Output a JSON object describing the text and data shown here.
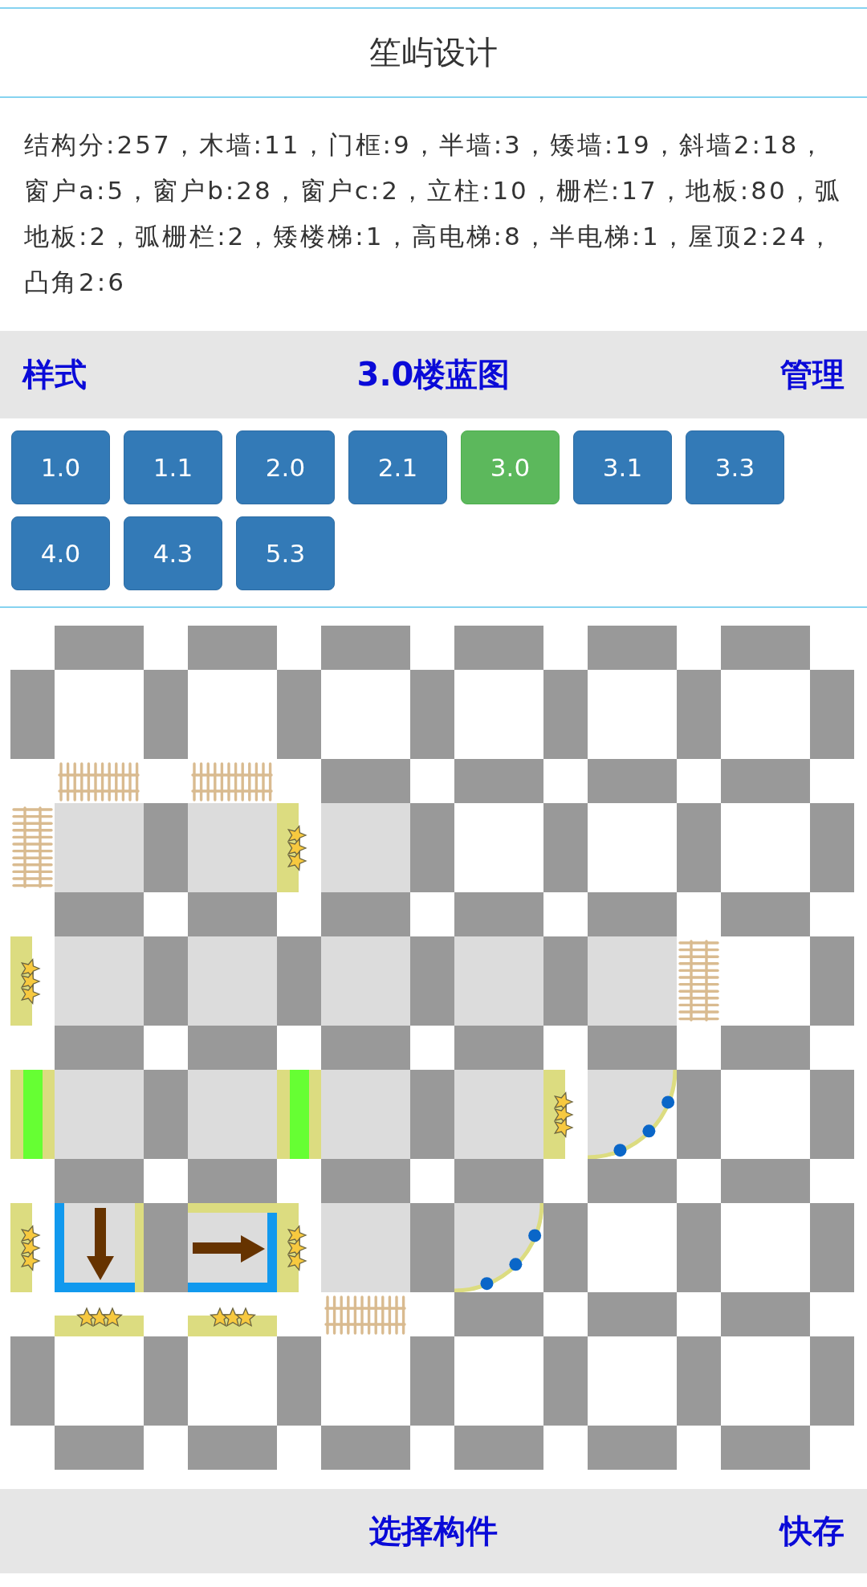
{
  "header": {
    "title": "笙屿设计"
  },
  "summary": "结构分:257，木墙:11，门框:9，半墙:3，矮墙:19，斜墙2:18，窗户a:5，窗户b:28，窗户c:2，立柱:10，栅栏:17，地板:80，弧地板:2，弧栅栏:2，矮楼梯:1，高电梯:8，半电梯:1，屋顶2:24，凸角2:6",
  "toolbar": {
    "left": "样式",
    "title": "3.0楼蓝图",
    "right": "管理"
  },
  "floors": [
    {
      "label": "1.0",
      "selected": false
    },
    {
      "label": "1.1",
      "selected": false
    },
    {
      "label": "2.0",
      "selected": false
    },
    {
      "label": "2.1",
      "selected": false
    },
    {
      "label": "3.0",
      "selected": true
    },
    {
      "label": "3.1",
      "selected": false
    },
    {
      "label": "3.3",
      "selected": false
    },
    {
      "label": "4.0",
      "selected": false
    },
    {
      "label": "4.3",
      "selected": false
    },
    {
      "label": "5.3",
      "selected": false
    }
  ],
  "board": {
    "rows": [
      {
        "tiles": [
          {
            "kind": "none"
          },
          {
            "kind": "none"
          },
          {
            "kind": "none"
          },
          {
            "kind": "none"
          },
          {
            "kind": "none"
          },
          {
            "kind": "none"
          },
          {
            "kind": "none"
          },
          {
            "kind": "none"
          },
          {
            "kind": "none"
          },
          {
            "kind": "none"
          },
          {
            "kind": "none"
          },
          {
            "kind": "none"
          },
          {
            "kind": "none"
          }
        ]
      },
      {
        "tiles": [
          {
            "kind": "none"
          },
          {
            "kind": "none"
          },
          {
            "kind": "none"
          },
          {
            "kind": "none"
          },
          {
            "kind": "none"
          },
          {
            "kind": "none"
          },
          {
            "kind": "none"
          },
          {
            "kind": "none"
          },
          {
            "kind": "none"
          },
          {
            "kind": "none"
          },
          {
            "kind": "none"
          },
          {
            "kind": "none"
          },
          {
            "kind": "none"
          }
        ]
      },
      {
        "tiles": [
          {
            "kind": "none"
          },
          {
            "kind": "fence"
          },
          {
            "kind": "none"
          },
          {
            "kind": "fence"
          },
          {
            "kind": "none"
          },
          {
            "kind": "none"
          },
          {
            "kind": "none"
          },
          {
            "kind": "none"
          },
          {
            "kind": "none"
          },
          {
            "kind": "none"
          },
          {
            "kind": "none"
          },
          {
            "kind": "none"
          },
          {
            "kind": "none"
          }
        ]
      },
      {
        "tiles": [
          {
            "kind": "fence"
          },
          {
            "kind": "floor"
          },
          {
            "kind": "none"
          },
          {
            "kind": "floor"
          },
          {
            "kind": "lowwall"
          },
          {
            "kind": "floor"
          },
          {
            "kind": "none"
          },
          {
            "kind": "none"
          },
          {
            "kind": "none"
          },
          {
            "kind": "none"
          },
          {
            "kind": "none"
          },
          {
            "kind": "none"
          },
          {
            "kind": "none"
          }
        ]
      },
      {
        "tiles": [
          {
            "kind": "none"
          },
          {
            "kind": "none"
          },
          {
            "kind": "none"
          },
          {
            "kind": "none"
          },
          {
            "kind": "none"
          },
          {
            "kind": "none"
          },
          {
            "kind": "none"
          },
          {
            "kind": "none"
          },
          {
            "kind": "none"
          },
          {
            "kind": "none"
          },
          {
            "kind": "none"
          },
          {
            "kind": "none"
          },
          {
            "kind": "none"
          }
        ]
      },
      {
        "tiles": [
          {
            "kind": "lowwall"
          },
          {
            "kind": "floor"
          },
          {
            "kind": "none"
          },
          {
            "kind": "floor"
          },
          {
            "kind": "none"
          },
          {
            "kind": "floor"
          },
          {
            "kind": "none"
          },
          {
            "kind": "floor"
          },
          {
            "kind": "none"
          },
          {
            "kind": "floor"
          },
          {
            "kind": "fence"
          },
          {
            "kind": "none"
          },
          {
            "kind": "none"
          }
        ]
      },
      {
        "tiles": [
          {
            "kind": "none"
          },
          {
            "kind": "none"
          },
          {
            "kind": "none"
          },
          {
            "kind": "none"
          },
          {
            "kind": "none"
          },
          {
            "kind": "none"
          },
          {
            "kind": "none"
          },
          {
            "kind": "none"
          },
          {
            "kind": "none"
          },
          {
            "kind": "none"
          },
          {
            "kind": "none"
          },
          {
            "kind": "none"
          },
          {
            "kind": "none"
          }
        ]
      },
      {
        "tiles": [
          {
            "kind": "door"
          },
          {
            "kind": "floor"
          },
          {
            "kind": "none"
          },
          {
            "kind": "floor"
          },
          {
            "kind": "door"
          },
          {
            "kind": "floor"
          },
          {
            "kind": "none"
          },
          {
            "kind": "floor"
          },
          {
            "kind": "lowwall"
          },
          {
            "kind": "arc"
          },
          {
            "kind": "none"
          },
          {
            "kind": "none"
          },
          {
            "kind": "none"
          }
        ]
      },
      {
        "tiles": [
          {
            "kind": "none"
          },
          {
            "kind": "none"
          },
          {
            "kind": "none"
          },
          {
            "kind": "none"
          },
          {
            "kind": "none"
          },
          {
            "kind": "none"
          },
          {
            "kind": "none"
          },
          {
            "kind": "none"
          },
          {
            "kind": "none"
          },
          {
            "kind": "none"
          },
          {
            "kind": "none"
          },
          {
            "kind": "none"
          },
          {
            "kind": "none"
          }
        ]
      },
      {
        "tiles": [
          {
            "kind": "lowwall"
          },
          {
            "kind": "stair-down"
          },
          {
            "kind": "none"
          },
          {
            "kind": "stair-right"
          },
          {
            "kind": "lowwall"
          },
          {
            "kind": "floor"
          },
          {
            "kind": "none"
          },
          {
            "kind": "arc"
          },
          {
            "kind": "none"
          },
          {
            "kind": "none"
          },
          {
            "kind": "none"
          },
          {
            "kind": "none"
          },
          {
            "kind": "none"
          }
        ]
      },
      {
        "tiles": [
          {
            "kind": "none"
          },
          {
            "kind": "lowwall"
          },
          {
            "kind": "none"
          },
          {
            "kind": "lowwall"
          },
          {
            "kind": "none"
          },
          {
            "kind": "fence"
          },
          {
            "kind": "none"
          },
          {
            "kind": "none"
          },
          {
            "kind": "none"
          },
          {
            "kind": "none"
          },
          {
            "kind": "none"
          },
          {
            "kind": "none"
          },
          {
            "kind": "none"
          }
        ]
      },
      {
        "tiles": [
          {
            "kind": "none"
          },
          {
            "kind": "none"
          },
          {
            "kind": "none"
          },
          {
            "kind": "none"
          },
          {
            "kind": "none"
          },
          {
            "kind": "none"
          },
          {
            "kind": "none"
          },
          {
            "kind": "none"
          },
          {
            "kind": "none"
          },
          {
            "kind": "none"
          },
          {
            "kind": "none"
          },
          {
            "kind": "none"
          },
          {
            "kind": "none"
          }
        ]
      },
      {
        "tiles": [
          {
            "kind": "none"
          },
          {
            "kind": "none"
          },
          {
            "kind": "none"
          },
          {
            "kind": "none"
          },
          {
            "kind": "none"
          },
          {
            "kind": "none"
          },
          {
            "kind": "none"
          },
          {
            "kind": "none"
          },
          {
            "kind": "none"
          },
          {
            "kind": "none"
          },
          {
            "kind": "none"
          },
          {
            "kind": "none"
          },
          {
            "kind": "none"
          }
        ]
      }
    ]
  },
  "bottom_bar": {
    "title": "选择构件",
    "right": "快存"
  }
}
